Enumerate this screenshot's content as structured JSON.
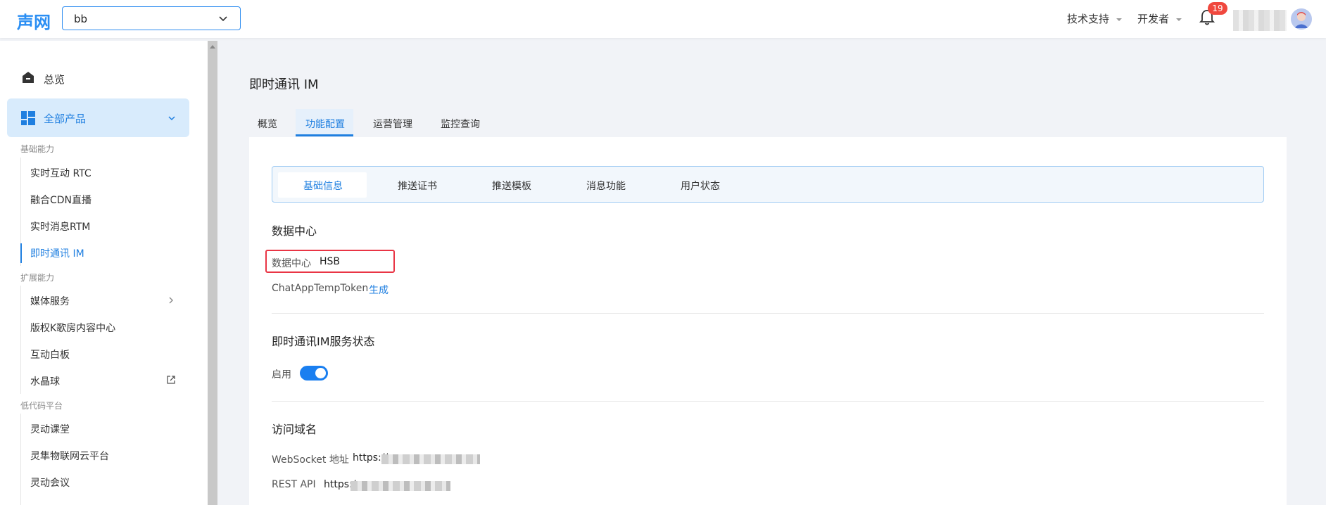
{
  "header": {
    "logo": "声网",
    "project_select": {
      "value": "bb"
    },
    "menus": [
      "技术支持",
      "开发者"
    ],
    "notifications_count": "19"
  },
  "sidebar": {
    "overview": "总览",
    "all_products": "全部产品",
    "groups": [
      {
        "title": "基础能力",
        "items": [
          "实时互动 RTC",
          "融合CDN直播",
          "实时消息RTM",
          "即时通讯 IM"
        ]
      },
      {
        "title": "扩展能力",
        "items": [
          "媒体服务",
          "版权K歌房内容中心",
          "互动白板",
          "水晶球"
        ]
      },
      {
        "title": "低代码平台",
        "items": [
          "灵动课堂",
          "灵隼物联网云平台",
          "灵动会议"
        ]
      }
    ],
    "active_item": "即时通讯 IM"
  },
  "main": {
    "title": "即时通讯 IM",
    "tabs": [
      "概览",
      "功能配置",
      "运营管理",
      "监控查询"
    ],
    "active_tab": "功能配置",
    "subtabs": [
      "基础信息",
      "推送证书",
      "推送模板",
      "消息功能",
      "用户状态"
    ],
    "active_subtab": "基础信息",
    "data_center": {
      "section_title": "数据中心",
      "label": "数据中心",
      "value": "HSB",
      "token_label": "ChatAppTempToken",
      "token_action": "生成"
    },
    "service_status": {
      "section_title": "即时通讯IM服务状态",
      "label": "启用",
      "enabled": true
    },
    "domains": {
      "section_title": "访问域名",
      "websocket_label": "WebSocket 地址",
      "websocket_value": "https://",
      "rest_label": "REST API",
      "rest_value": "https:/"
    }
  },
  "colors": {
    "accent": "#1f7fe0",
    "highlight": "#e93545",
    "badge": "#f0483e"
  }
}
